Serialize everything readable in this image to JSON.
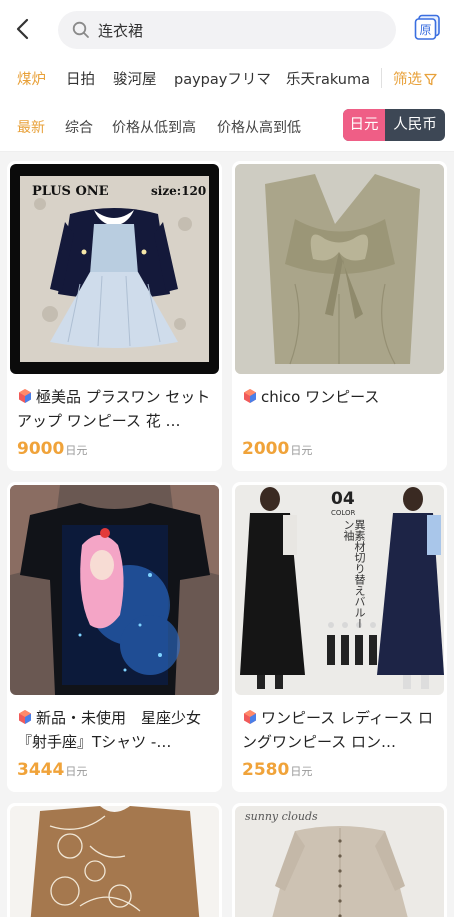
{
  "search": {
    "query": "连衣裙"
  },
  "sources": [
    {
      "label": "煤炉",
      "active": true
    },
    {
      "label": "日拍",
      "active": false
    },
    {
      "label": "骏河屋",
      "active": false
    },
    {
      "label": "paypayフリマ",
      "active": false
    },
    {
      "label": "乐天rakuma",
      "active": false
    }
  ],
  "filter_label": "筛选",
  "sorts": [
    {
      "label": "最新",
      "active": true
    },
    {
      "label": "综合",
      "active": false
    },
    {
      "label": "价格从低到高",
      "active": false
    },
    {
      "label": "价格从高到低",
      "active": false
    }
  ],
  "currency": {
    "jpy": "日元",
    "cny": "人民币",
    "selected": "日元"
  },
  "products": [
    {
      "title": "極美品 プラスワン セットアップ ワンピース 花 …",
      "price": "9000",
      "unit": "日元",
      "image": "navy bolero dress photo",
      "overlay_left": "PLUS ONE",
      "overlay_right": "size:120"
    },
    {
      "title": "chico ワンピース",
      "price": "2000",
      "unit": "日元",
      "image": "beige bow dress photo"
    },
    {
      "title": "新品・未使用　星座少女『射手座』Tシャツ -…",
      "price": "3444",
      "unit": "日元",
      "image": "anime print t-shirt photo"
    },
    {
      "title": "ワンピース レディース ロングワンピース ロン…",
      "price": "2580",
      "unit": "日元",
      "image": "long dress models photo",
      "overlay_num": "04",
      "overlay_color": "COLOR",
      "overlay_vertical": "異素材切り替えバルーン袖"
    },
    {
      "title": "",
      "price": "",
      "unit": "",
      "image": "lace dress photo"
    },
    {
      "title": "",
      "price": "",
      "unit": "",
      "image": "linen dress photo",
      "overlay_brand": "sunny clouds"
    }
  ]
}
